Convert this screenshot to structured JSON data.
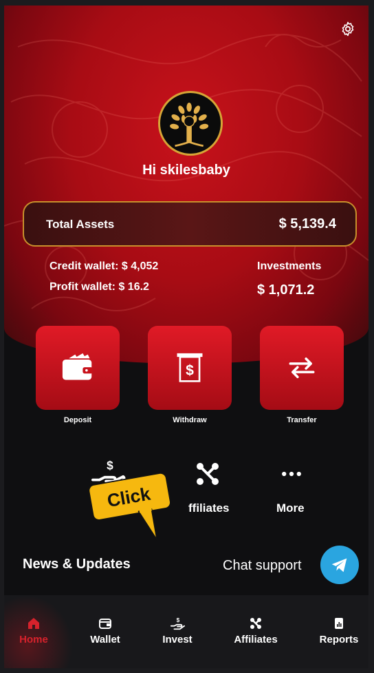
{
  "header": {
    "settings_icon": "gear-icon"
  },
  "profile": {
    "greeting": "Hi skilesbaby",
    "logo_icon": "tree-logo-icon"
  },
  "assets": {
    "label": "Total Assets",
    "value": "$ 5,139.4"
  },
  "wallets": {
    "credit": "Credit wallet: $ 4,052",
    "profit": "Profit wallet: $ 16.2",
    "investments_label": "Investments",
    "investments_value": "$ 1,071.2"
  },
  "actions": [
    {
      "label": "Deposit",
      "icon": "wallet-icon"
    },
    {
      "label": "Withdraw",
      "icon": "withdraw-receipt-icon"
    },
    {
      "label": "Transfer",
      "icon": "transfer-arrows-icon"
    }
  ],
  "row2": [
    {
      "label": "",
      "icon": "invest-hand-dollar-icon"
    },
    {
      "label": "ffiliates",
      "icon": "affiliates-nodes-icon"
    },
    {
      "label": "More",
      "icon": "more-dots-icon"
    }
  ],
  "news": {
    "label": "News & Updates"
  },
  "chat": {
    "label": "Chat support",
    "icon": "telegram-icon"
  },
  "callout": {
    "text": "Click"
  },
  "nav": [
    {
      "label": "Home",
      "icon": "home-icon",
      "active": true
    },
    {
      "label": "Wallet",
      "icon": "wallet-icon"
    },
    {
      "label": "Invest",
      "icon": "invest-icon"
    },
    {
      "label": "Affiliates",
      "icon": "affiliates-icon"
    },
    {
      "label": "Reports",
      "icon": "reports-icon"
    }
  ],
  "colors": {
    "accent": "#d7222c",
    "gold": "#c8902c",
    "telegram": "#2aa5e0",
    "callout": "#f6b80f"
  }
}
